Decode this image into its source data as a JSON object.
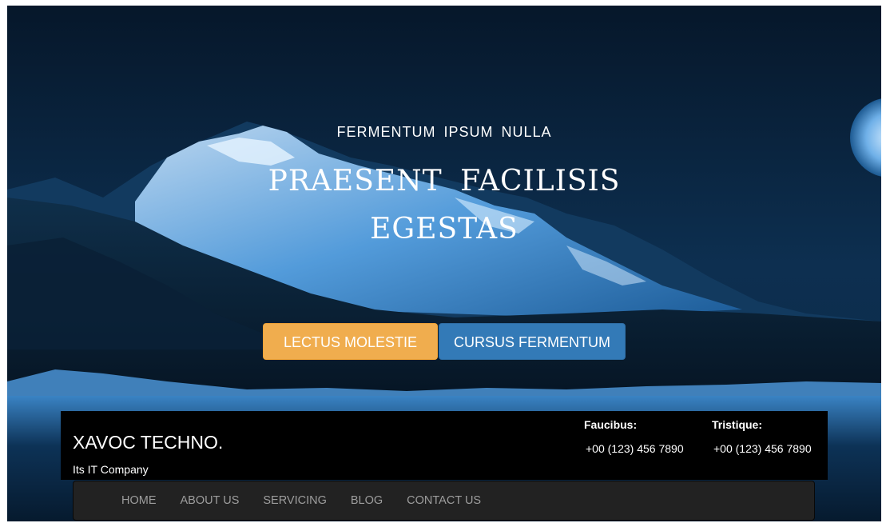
{
  "hero": {
    "kicker": "FERMENTUM  IPSUM  NULLA",
    "headline_line1": "PRAESENT  FACILISIS",
    "headline_line2": "EGESTAS",
    "primary_button": "LECTUS MOLESTIE",
    "secondary_button": "CURSUS FERMENTUM"
  },
  "brand": {
    "name": "XAVOC TECHNO.",
    "tagline": "Its IT Company"
  },
  "contacts": [
    {
      "label": "Faucibus:",
      "phone": "+00 (123) 456 7890"
    },
    {
      "label": "Tristique:",
      "phone": "+00 (123) 456 7890"
    }
  ],
  "nav": {
    "items": [
      "HOME",
      "ABOUT US",
      "SERVICING",
      "BLOG",
      "CONTACT US"
    ]
  },
  "colors": {
    "primary_button": "#f0ad4e",
    "secondary_button": "#337ab7",
    "navbar": "#222222",
    "nav_text": "#9d9d9d"
  }
}
